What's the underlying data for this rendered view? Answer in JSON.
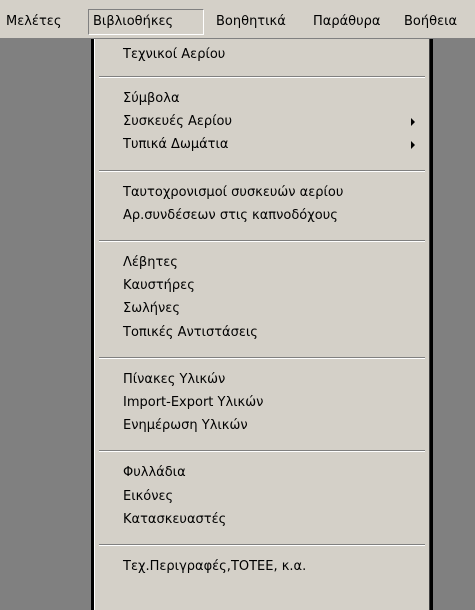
{
  "menubar": {
    "items": [
      {
        "label": "Μελέτες"
      },
      {
        "label": "Βιβλιοθήκες"
      },
      {
        "label": "Βοηθητικά"
      },
      {
        "label": "Παράθυρα"
      },
      {
        "label": "Βοήθεια"
      }
    ]
  },
  "dropdown": {
    "items": [
      {
        "label": "Τεχνικοί Αερίου"
      },
      {
        "label": "Σύμβολα"
      },
      {
        "label": "Συσκευές Αερίου"
      },
      {
        "label": "Τυπικά Δωμάτια"
      },
      {
        "label": "Ταυτοχρονισμοί συσκευών αερίου"
      },
      {
        "label": "Αρ.συνδέσεων στις καπνοδόχους"
      },
      {
        "label": "Λέβητες"
      },
      {
        "label": "Καυστήρες"
      },
      {
        "label": "Σωλήνες"
      },
      {
        "label": "Τοπικές Αντιστάσεις"
      },
      {
        "label": "Πίνακες Υλικών"
      },
      {
        "label": "Import-Export Υλικών"
      },
      {
        "label": "Ενημέρωση Υλικών"
      },
      {
        "label": "Φυλλάδια"
      },
      {
        "label": "Εικόνες"
      },
      {
        "label": "Κατασκευαστές"
      },
      {
        "label": "Τεχ.Περιγραφές,ΤΟΤΕΕ, κ.α."
      }
    ]
  }
}
